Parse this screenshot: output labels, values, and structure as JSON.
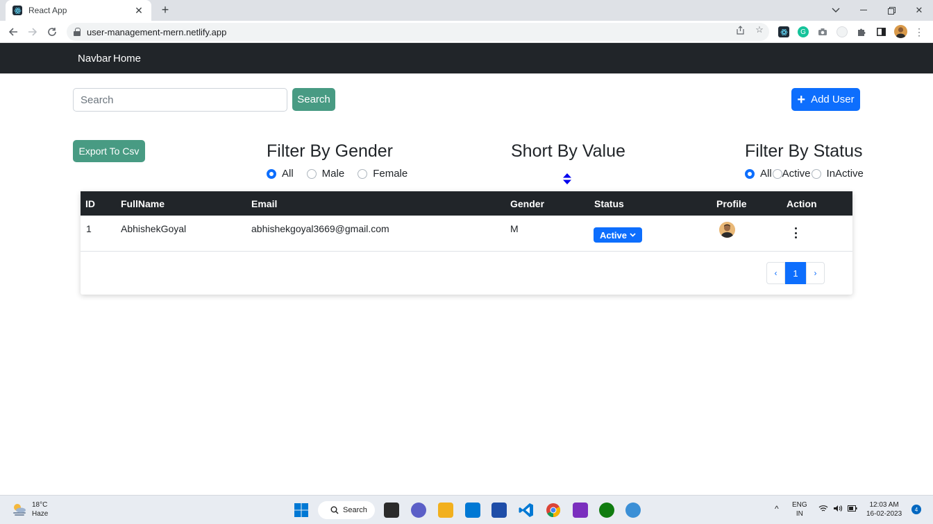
{
  "browser": {
    "tab_title": "React App",
    "url": "user-management-mern.netlify.app"
  },
  "navbar": {
    "brand": "Navbar",
    "home": "Home"
  },
  "search": {
    "placeholder": "Search",
    "button_label": "Search"
  },
  "add_user_label": "Add User",
  "export_label": "Export To Csv",
  "gender_filter": {
    "title": "Filter By Gender",
    "options": [
      "All",
      "Male",
      "Female"
    ],
    "selected": "All"
  },
  "sort": {
    "title": "Short By Value"
  },
  "status_filter": {
    "title": "Filter By Status",
    "options": [
      "All",
      "Active",
      "InActive"
    ],
    "selected": "All"
  },
  "table": {
    "headers": [
      "ID",
      "FullName",
      "Email",
      "Gender",
      "Status",
      "Profile",
      "Action"
    ],
    "rows": [
      {
        "id": "1",
        "fullname": "AbhishekGoyal",
        "email": "abhishekgoyal3669@gmail.com",
        "gender": "M",
        "status": "Active"
      }
    ]
  },
  "pagination": {
    "prev": "‹",
    "current": "1",
    "next": "›"
  },
  "taskbar": {
    "temperature": "18°C",
    "weather": "Haze",
    "search_label": "Search",
    "lang": "ENG",
    "region": "IN",
    "time": "12:03 AM",
    "date": "16-02-2023",
    "notifications": "4"
  },
  "colors": {
    "navbar": "#212529",
    "primary": "#0d6efd",
    "success": "#489b83"
  }
}
